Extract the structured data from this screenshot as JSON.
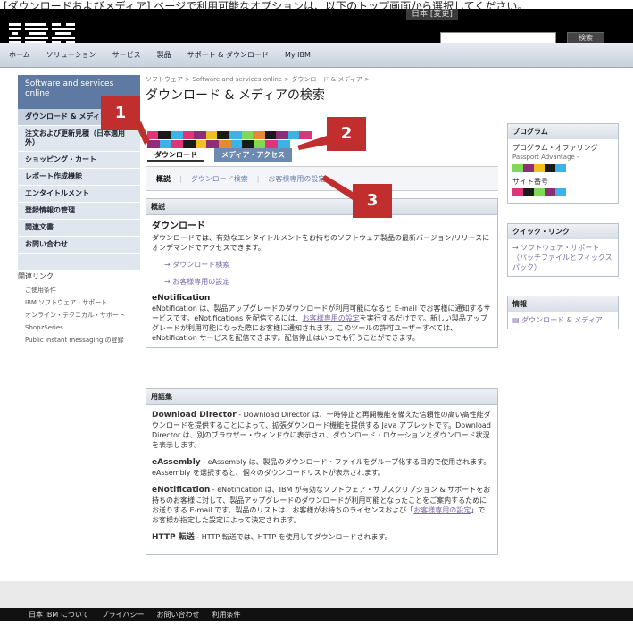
{
  "caption": "[ダウンロードおよびメディア] ページで利用可能なオプションは、以下のトップ画面から選択してください。",
  "masthead": {
    "locale": "日本 [変更]",
    "search_placeholder": "",
    "search_button": "検索"
  },
  "nav": [
    "ホーム",
    "ソリューション",
    "サービス",
    "製品",
    "サポート & ダウンロード",
    "My IBM"
  ],
  "breadcrumb": "ソフトウェア > Software and services online > ダウンロード & メディア >",
  "page_title": "ダウンロード & メディアの検索",
  "sidebar": {
    "header": "Software and services online",
    "items": [
      "ダウンロード & メディア",
      "注文および更新見積（日本適用外）",
      "ショッピング・カート",
      "レポート作成機能",
      "エンタイトルメント",
      "登録情報の管理",
      "関連文書",
      "お問い合わせ"
    ]
  },
  "related": {
    "title": "関連リンク",
    "items": [
      "ご使用条件",
      "IBM ソフトウェア・サポート",
      "オンライン・テクニカル・サポート",
      "ShopzSeries",
      "Public instant messaging の登録"
    ]
  },
  "tabs": {
    "download": "ダウンロード",
    "media": "メディア・アクセス"
  },
  "subtabs": {
    "overview": "概説",
    "download_search": "ダウンロード検索",
    "preferences": "お客様専用の設定"
  },
  "overview": {
    "header": "概説",
    "title": "ダウンロード",
    "body": "ダウンロードでは、有効なエンタイトルメントをお持ちのソフトウェア製品の最新バージョン/リリースにオンデマンドでアクセスできます。",
    "link1": "→ ダウンロード検索",
    "link2": "→ お客様専用の設定",
    "enotif_title": "eNotification",
    "enotif_body_1": "eNotification は、製品アップグレードのダウンロードが利用可能になると E-mail でお客様に通知するサービスです。eNotifications を配信するには、",
    "enotif_link": "お客様専用の設定",
    "enotif_body_2": "を実行するだけです。新しい製品アップグレードが利用可能になった際にお客様に通知されます。このツールの許可ユーザーすべては、eNotification サービスを配信できます。配信停止はいつでも行うことができます。"
  },
  "glossary": {
    "header": "用語集",
    "dd_term": "Download Director",
    "dd_body": " - Download Director は、一時停止と再開機能を備えた信頼性の高い高性能ダウンロードを提供することによって、拡張ダウンロード機能を提供する Java アプレットです。Download Director は、別のブラウザー・ウィンドウに表示され、ダウンロード・ロケーションとダウンロード状況を表示します。",
    "ea_term": "eAssembly",
    "ea_body": " - eAssembly は、製品のダウンロード・ファイルをグループ化する目的で使用されます。eAssembly を選択すると、個々のダウンロードリストが表示されます。",
    "en_term": "eNotification",
    "en_body_1": " - eNotification は、IBM が有効なソフトウェア・サブスクリプション & サポートをお持ちのお客様に対して、製品アップグレードのダウンロードが利用可能となったことをご案内するためにお送りする E-mail です。製品のリストは、お客様がお持ちのライセンスおよび「",
    "en_link": "お客様専用の設定",
    "en_body_2": "」でお客様が指定した設定によって決定されます。",
    "http_term": "HTTP 転送",
    "http_body": " - HTTP 転送では、HTTP を使用してダウンロードされます。"
  },
  "right": {
    "program_header": "プログラム",
    "program_label": "プログラム・オファリング",
    "program_sub": "Passport Advantage -",
    "site_label": "サイト番号",
    "quick_header": "クイック・リンク",
    "quick_link": "→ ソフトウェア・サポート（パッチファイルとフィックスパック）",
    "info_header": "情報",
    "info_link": "ダウンロード & メディア"
  },
  "footer": [
    "日本 IBM について",
    "プライバシー",
    "お問い合わせ",
    "利用条件"
  ],
  "callouts": [
    "1",
    "2",
    "3"
  ]
}
